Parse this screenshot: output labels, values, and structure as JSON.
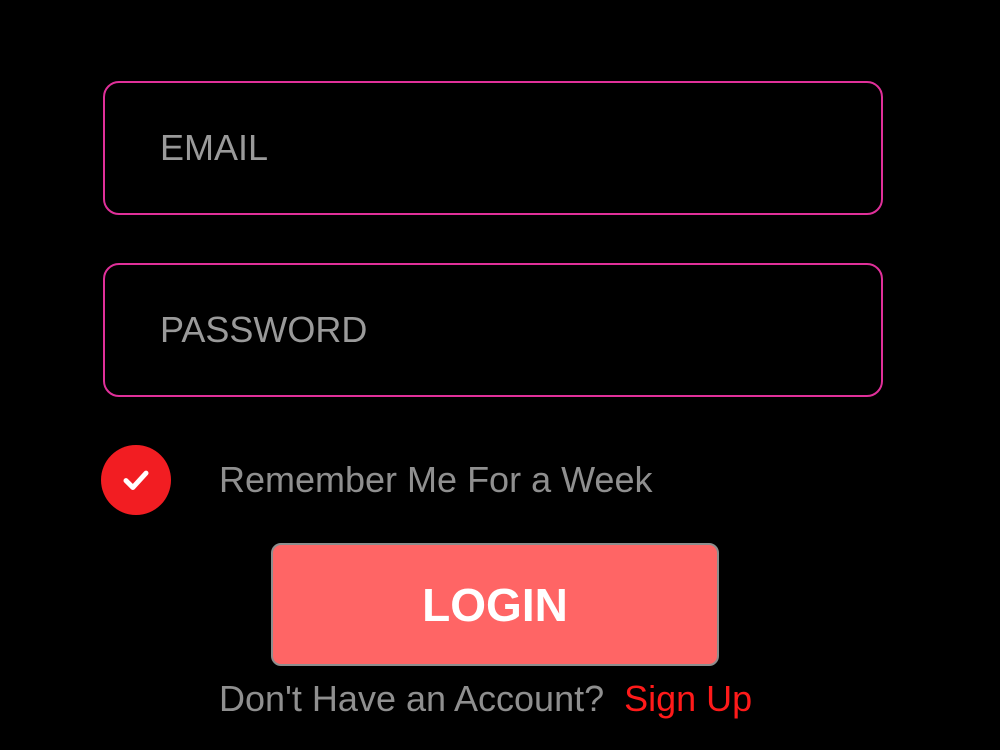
{
  "form": {
    "email": {
      "placeholder": "EMAIL",
      "value": ""
    },
    "password": {
      "placeholder": "PASSWORD",
      "value": ""
    },
    "remember": {
      "label": "Remember Me For a Week",
      "checked": true
    },
    "login_label": "LOGIN",
    "signup_prompt": "Don't Have an Account?",
    "signup_link": "Sign Up"
  },
  "colors": {
    "background": "#000000",
    "field_border": "#e0309a",
    "checkbox": "#f21d22",
    "login_button": "#ff6565",
    "signup_link": "#ff1a1a",
    "muted_text": "#8f8f8f"
  },
  "icons": {
    "checkbox_icon": "checkmark-icon"
  }
}
